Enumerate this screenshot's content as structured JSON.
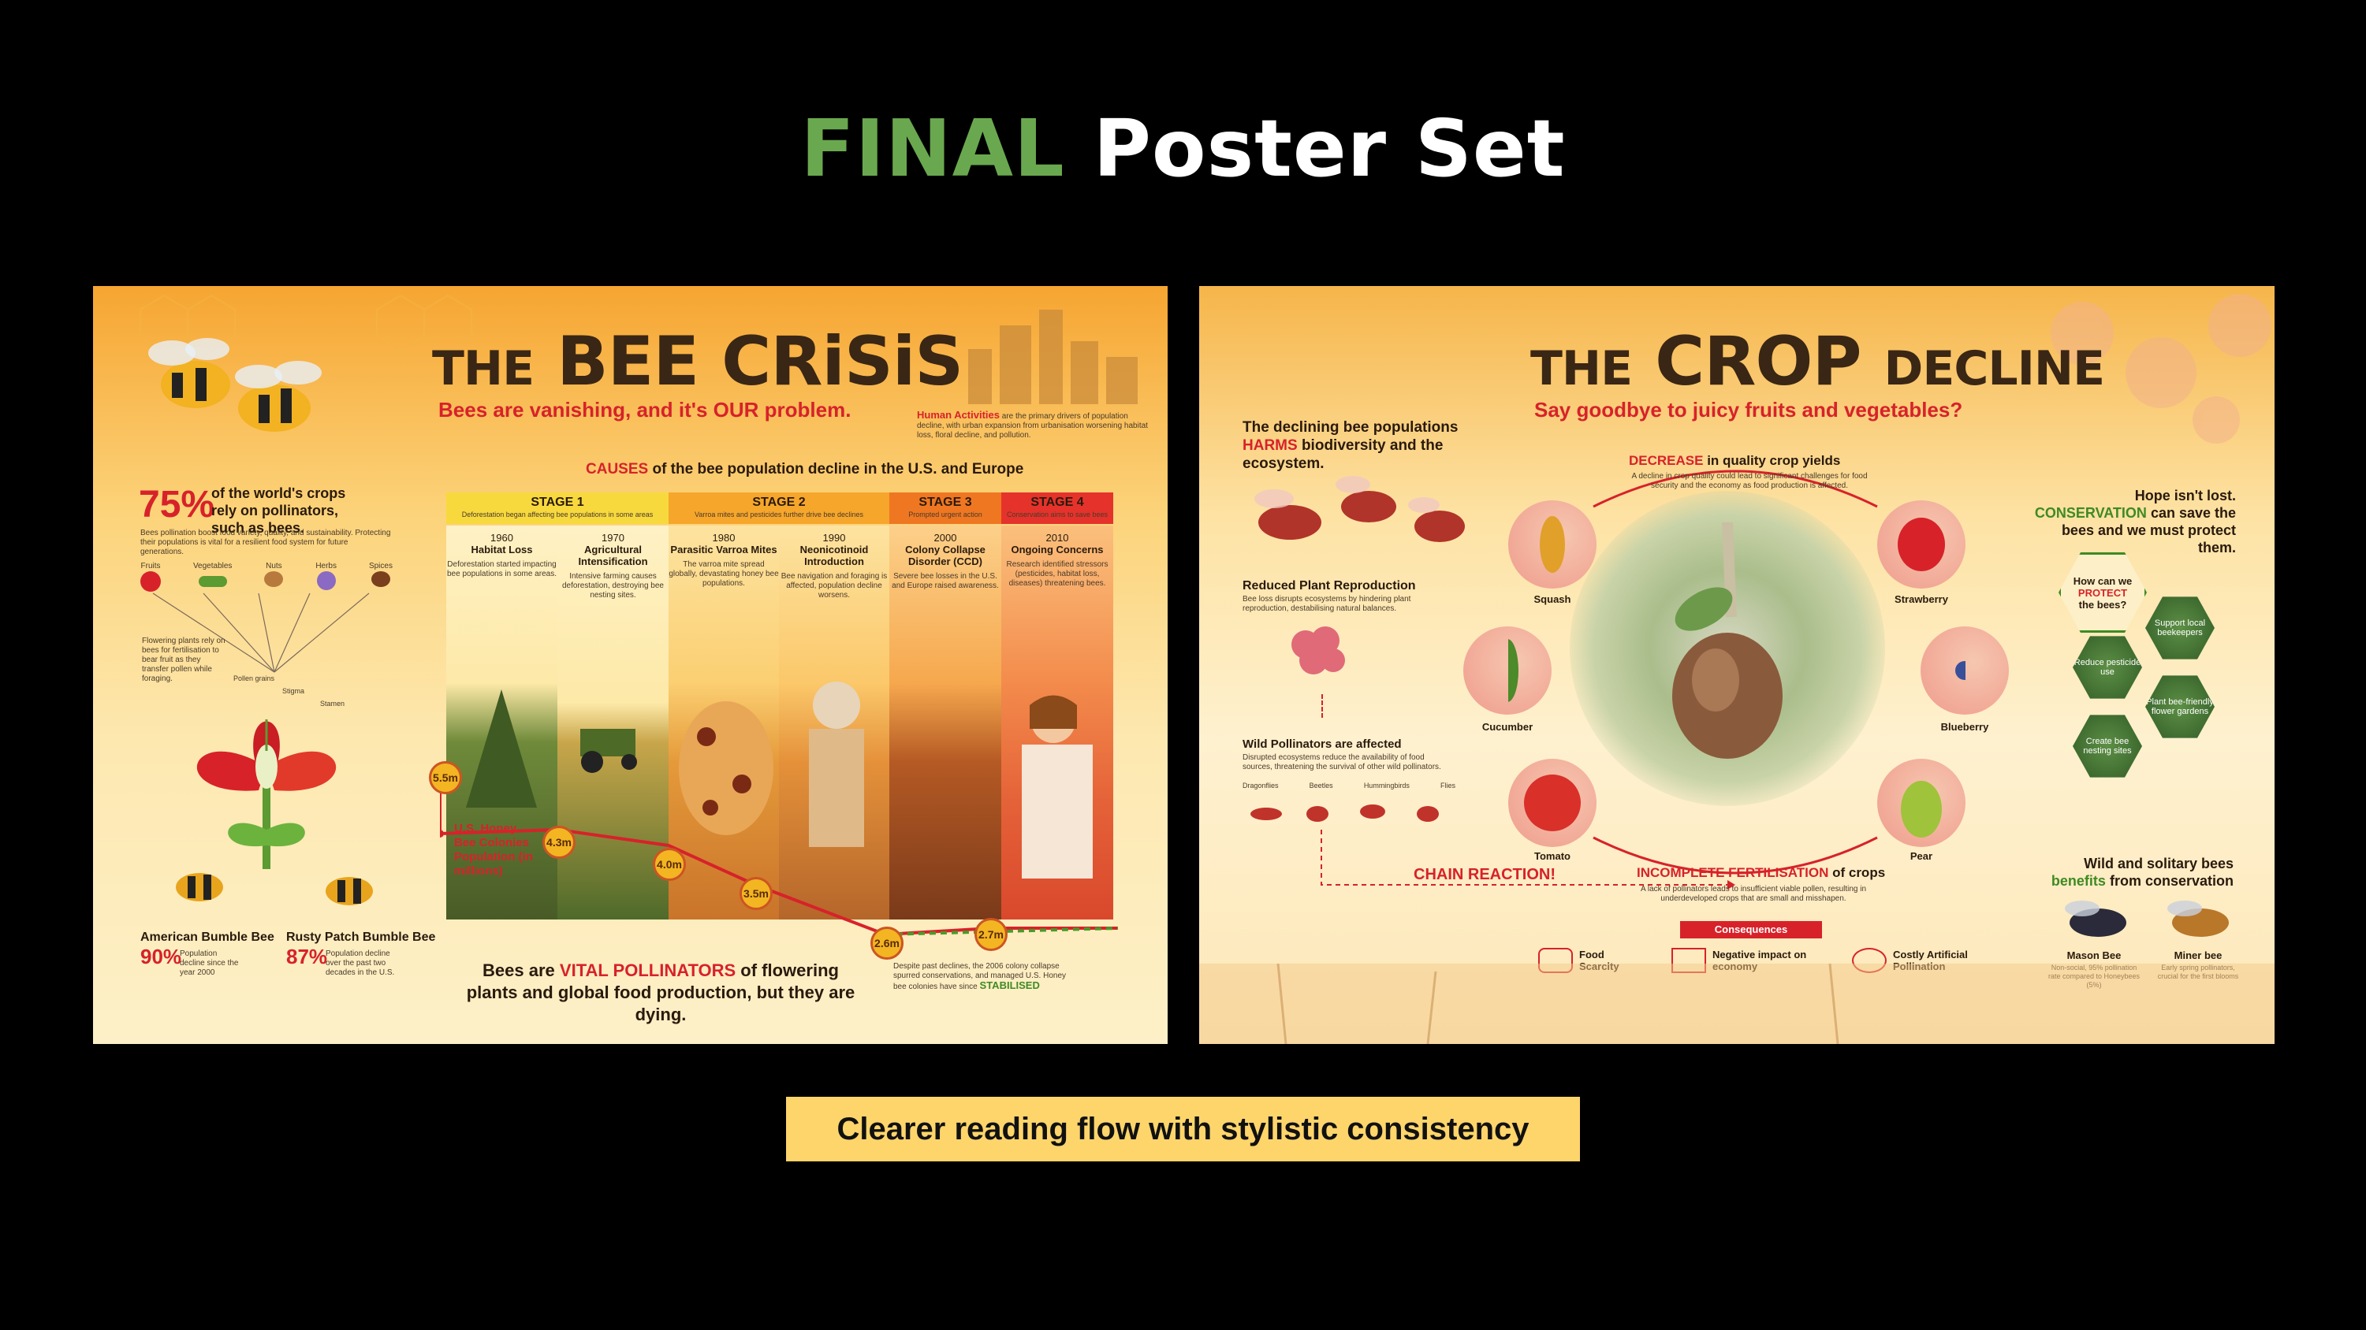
{
  "header": {
    "title_part1": "FINAL",
    "title_part2": "Poster Set"
  },
  "colors": {
    "accent_green": "#6aa84f",
    "caption_bg": "#fdd56b",
    "poster_red": "#d7222a"
  },
  "poster1": {
    "title_the": "THE",
    "title_main": "BEE CRiSiS",
    "tagline": "Bees are vanishing, and it's OUR problem.",
    "human_activities_heading": "Human Activities",
    "human_activities_text": "are the primary drivers of population decline, with urban expansion from urbanisation worsening habitat loss, floral decline, and pollution.",
    "stat_75": "75%",
    "stat_75_text": "of the world's crops rely on pollinators, such as bees.",
    "stat_75_sub": "Bees pollination boost food variety, quality, and sustainability. Protecting their populations is vital for a resilient food system for future generations.",
    "crop_icons": [
      "Fruits",
      "Vegetables",
      "Nuts",
      "Herbs",
      "Spices"
    ],
    "flower_text": "Flowering plants rely on bees for fertilisation to bear fruit as they transfer pollen while foraging.",
    "flower_labels": [
      "Pollen grains",
      "Stigma",
      "Stamen"
    ],
    "causes_heading_red": "CAUSES",
    "causes_heading_rest": "of the bee population decline in the U.S. and Europe",
    "stages": [
      {
        "label": "STAGE 1",
        "sub": "Deforestation began affecting bee populations in some areas",
        "color": "#f7d93e"
      },
      {
        "label": "STAGE 2",
        "sub": "Varroa mites and pesticides further drive bee declines",
        "color": "#f6a62b"
      },
      {
        "label": "STAGE 3",
        "sub": "Prompted urgent action",
        "color": "#ef7722"
      },
      {
        "label": "STAGE 4",
        "sub": "Conservation aims to save bees",
        "color": "#e5322b"
      }
    ],
    "events": [
      {
        "year": "1960",
        "title": "Habitat Loss",
        "text": "Deforestation started impacting bee populations in some areas."
      },
      {
        "year": "1970",
        "title": "Agricultural Intensification",
        "text": "Intensive farming causes deforestation, destroying bee nesting sites."
      },
      {
        "year": "1980",
        "title": "Parasitic Varroa Mites",
        "text": "The varroa mite spread globally, devastating honey bee populations."
      },
      {
        "year": "1990",
        "title": "Neonicotinoid Introduction",
        "text": "Bee navigation and foraging is affected, population decline worsens."
      },
      {
        "year": "2000",
        "title": "Colony Collapse Disorder (CCD)",
        "text": "Severe bee losses in the U.S. and Europe raised awareness."
      },
      {
        "year": "2010",
        "title": "Ongoing Concerns",
        "text": "Research identified stressors (pesticides, habitat loss, diseases) threatening bees."
      }
    ],
    "population_label": "U.S. Honey Bee Colonies Population (in millions)",
    "population_points": [
      "5.5m",
      "4.3m",
      "4.0m",
      "3.5m",
      "2.6m",
      "2.7m"
    ],
    "stabilised_text": "Despite past declines, the 2006 colony collapse spurred conservations, and managed U.S. Honey bee colonies have since",
    "stabilised_word": "STABILISED",
    "bees": [
      {
        "name": "American Bumble Bee",
        "pct": "90%",
        "text": "Population decline since the year 2000"
      },
      {
        "name": "Rusty Patch Bumble Bee",
        "pct": "87%",
        "text": "Population decline over the past two decades in the U.S."
      }
    ],
    "footer_pre": "Bees are",
    "footer_red": "VITAL POLLINATORS",
    "footer_post": "of flowering plants and global food production, but they are dying."
  },
  "poster2": {
    "title_the": "THE",
    "title_main": "CROP",
    "title_end": "DECLINE",
    "tagline": "Say goodbye to juicy fruits and vegetables?",
    "harms_pre": "The declining bee populations",
    "harms_red": "HARMS",
    "harms_post": "biodiversity and the ecosystem.",
    "reduced_heading": "Reduced Plant Reproduction",
    "reduced_text": "Bee loss disrupts ecosystems by hindering plant reproduction, destabilising natural balances.",
    "wild_heading": "Wild Pollinators are affected",
    "wild_text": "Disrupted ecosystems reduce the availability of food sources, threatening the survival of other wild pollinators.",
    "wild_list": [
      "Dragonflies",
      "Beetles",
      "Hummingbirds",
      "Flies"
    ],
    "chain_reaction": "CHAIN REACTION!",
    "decrease_red": "DECREASE",
    "decrease_rest": "in quality crop yields",
    "decrease_text": "A decline in crop quality could lead to significant challenges for food security and the economy as food production is affected.",
    "crops": [
      "Squash",
      "Strawberry",
      "Cucumber",
      "Blueberry",
      "Tomato",
      "Pear"
    ],
    "incomplete_red": "INCOMPLETE FERTILISATION",
    "incomplete_rest": "of crops",
    "incomplete_text": "A lack of pollinators leads to insufficient viable pollen, resulting in underdeveloped crops that are small and misshapen.",
    "consequences_label": "Consequences",
    "consequences": [
      "Food Scarcity",
      "Negative impact on economy",
      "Costly Artificial Pollination"
    ],
    "hope_line1": "Hope isn't lost.",
    "hope_green": "CONSERVATION",
    "hope_line2": "can save the bees and we must protect them.",
    "howcan_pre": "How can we",
    "howcan_red": "PROTECT",
    "howcan_post": "the bees?",
    "actions": [
      "Support local beekeepers",
      "Reduce pesticide use",
      "Plant bee-friendly flower gardens",
      "Create bee nesting sites"
    ],
    "wild_solitary_line1": "Wild and solitary bees",
    "wild_solitary_green": "benefits",
    "wild_solitary_line2": "from conservation",
    "solitary": [
      {
        "name": "Mason Bee",
        "text": "Non-social, 95% pollination rate compared to Honeybees (5%)"
      },
      {
        "name": "Miner bee",
        "text": "Early spring pollinators, crucial for the first blooms"
      }
    ]
  },
  "caption": "Clearer reading flow with stylistic consistency"
}
